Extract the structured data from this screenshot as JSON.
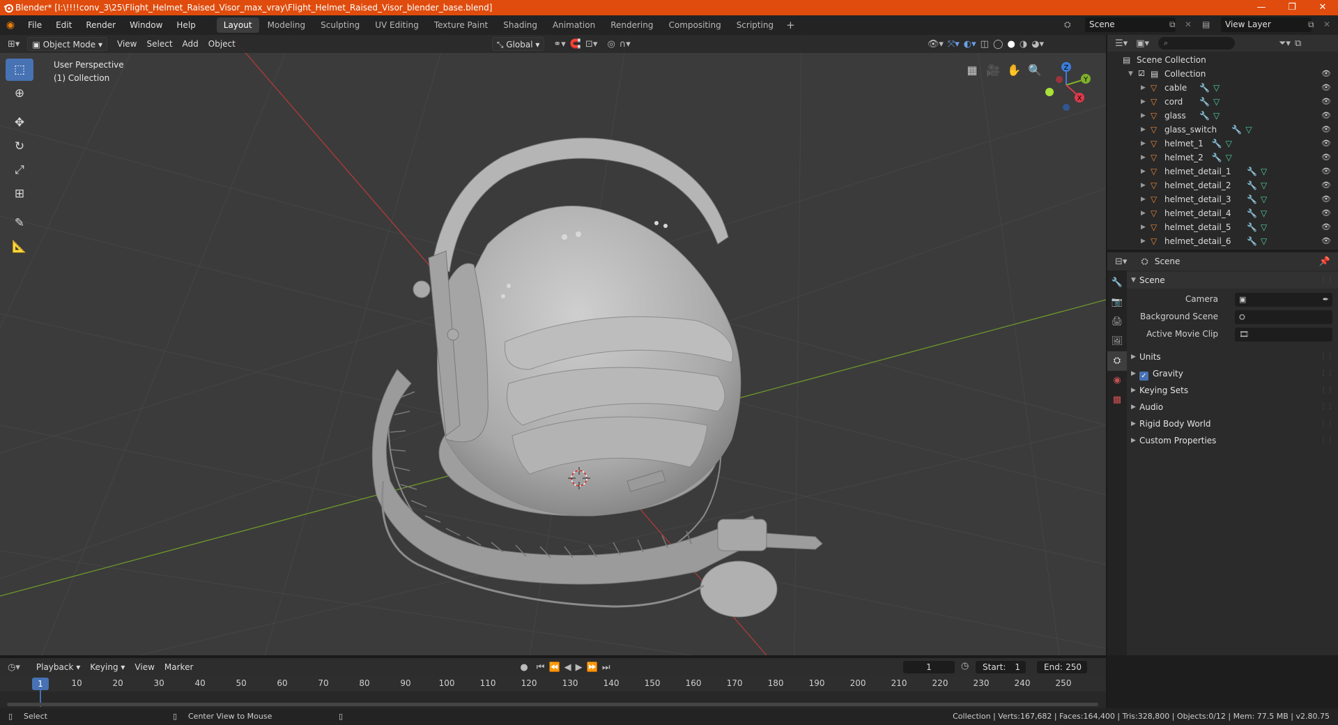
{
  "window": {
    "title": "Blender* [I:\\!!!!conv_3\\25\\Flight_Helmet_Raised_Visor_max_vray\\Flight_Helmet_Raised_Visor_blender_base.blend]",
    "controls": [
      "—",
      "❐",
      "✕"
    ]
  },
  "menu": [
    "File",
    "Edit",
    "Render",
    "Window",
    "Help"
  ],
  "workspaces": [
    {
      "label": "Layout",
      "active": true
    },
    {
      "label": "Modeling"
    },
    {
      "label": "Sculpting"
    },
    {
      "label": "UV Editing"
    },
    {
      "label": "Texture Paint"
    },
    {
      "label": "Shading"
    },
    {
      "label": "Animation"
    },
    {
      "label": "Rendering"
    },
    {
      "label": "Compositing"
    },
    {
      "label": "Scripting"
    }
  ],
  "workspace_add": "+",
  "scene_field": "Scene",
  "view_layer_field": "View Layer",
  "viewport": {
    "mode": "Object Mode",
    "menus": [
      "View",
      "Select",
      "Add",
      "Object"
    ],
    "orientation": "Global",
    "perspective": "User Perspective",
    "collection": "(1) Collection",
    "tools": [
      "select-box",
      "cursor",
      "move",
      "rotate",
      "scale",
      "transform",
      "annotate",
      "measure"
    ],
    "gizmo_axes": {
      "x": "X",
      "y": "Y",
      "z": "Z"
    },
    "colors": {
      "background": "#3b3b3b",
      "grid": "#454545",
      "x_axis": "#b03a3a",
      "y_axis": "#6f9a2a",
      "accent": "#4772b3"
    }
  },
  "outliner": {
    "root": "Scene Collection",
    "collection": "Collection",
    "items": [
      "cable",
      "cord",
      "glass",
      "glass_switch",
      "helmet_1",
      "helmet_2",
      "helmet_detail_1",
      "helmet_detail_2",
      "helmet_detail_3",
      "helmet_detail_4",
      "helmet_detail_5",
      "helmet_detail_6"
    ]
  },
  "properties": {
    "context": "Scene",
    "panel_scene": "Scene",
    "rows": [
      {
        "label": "Camera",
        "value": ""
      },
      {
        "label": "Background Scene",
        "value": ""
      },
      {
        "label": "Active Movie Clip",
        "value": ""
      }
    ],
    "panels": [
      {
        "label": "Units"
      },
      {
        "label": "Gravity",
        "checkbox": true
      },
      {
        "label": "Keying Sets"
      },
      {
        "label": "Audio"
      },
      {
        "label": "Rigid Body World"
      },
      {
        "label": "Custom Properties"
      }
    ]
  },
  "timeline": {
    "menus": [
      "Playback",
      "Keying",
      "View",
      "Marker"
    ],
    "current_frame": "1",
    "start_label": "Start:",
    "start": "1",
    "end_label": "End:",
    "end": "250",
    "playhead_label": "1",
    "ticks": [
      "10",
      "20",
      "30",
      "40",
      "50",
      "60",
      "70",
      "80",
      "90",
      "100",
      "110",
      "120",
      "130",
      "140",
      "150",
      "160",
      "170",
      "180",
      "190",
      "200",
      "210",
      "220",
      "230",
      "240",
      "250"
    ]
  },
  "status": {
    "left": "Select",
    "middle": "Center View to Mouse",
    "right": "Collection | Verts:167,682 | Faces:164,400 | Tris:328,800 | Objects:0/12 | Mem: 77.5 MB | v2.80.75"
  }
}
